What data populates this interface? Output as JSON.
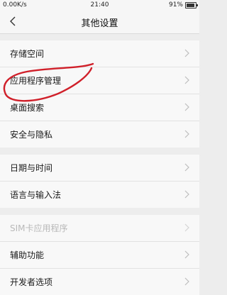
{
  "status_bar": {
    "network": "0.00K/s",
    "time": "21:40",
    "battery": "91%",
    "battery_level": 0.91
  },
  "header": {
    "title": "其他设置"
  },
  "groups": [
    [
      {
        "label": "存储空间"
      },
      {
        "label": "应用程序管理"
      },
      {
        "label": "桌面搜索"
      },
      {
        "label": "安全与隐私"
      }
    ],
    [
      {
        "label": "日期与时间"
      },
      {
        "label": "语言与输入法"
      }
    ],
    [
      {
        "label": "SIM卡应用程序",
        "disabled": true
      },
      {
        "label": "辅助功能"
      },
      {
        "label": "开发者选项"
      }
    ]
  ],
  "colors": {
    "annotation": "#d0202a",
    "background": "#ededed",
    "row_background": "#f8f8f8"
  }
}
